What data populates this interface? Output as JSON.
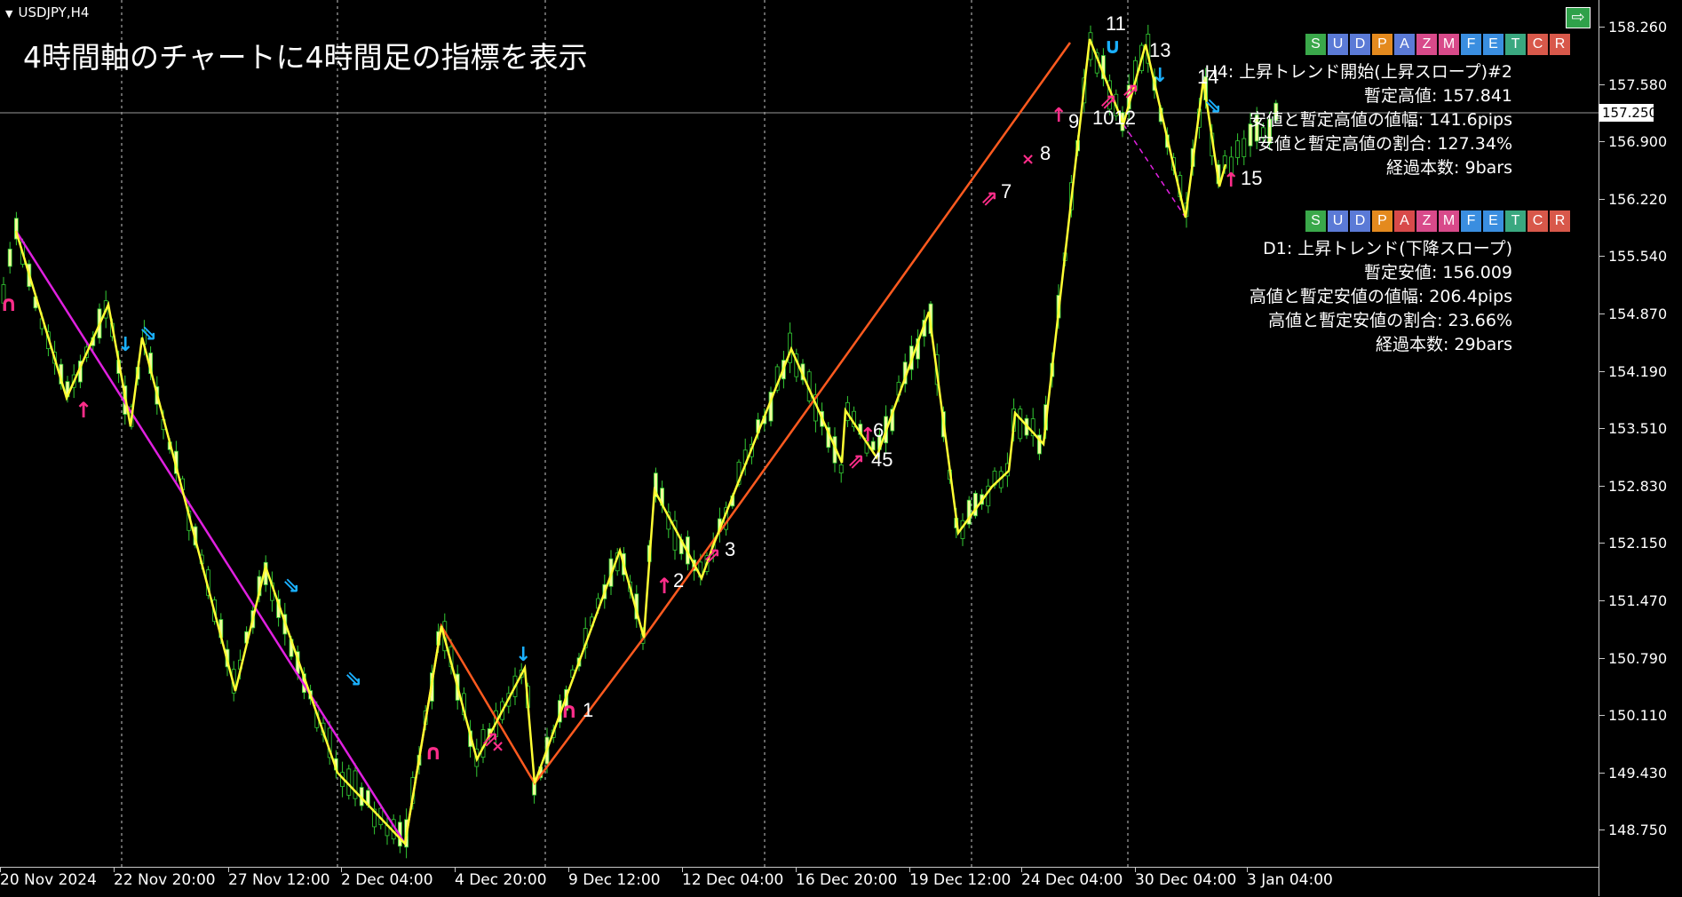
{
  "chart": {
    "symbol": "USDJPY,H4",
    "title": "4時間軸のチャートに4時間足の指標を表示",
    "current_price": "157.250"
  },
  "price_axis": [
    "158.260",
    "157.580",
    "156.900",
    "156.220",
    "155.540",
    "154.870",
    "154.190",
    "153.510",
    "152.830",
    "152.150",
    "151.470",
    "150.790",
    "150.110",
    "149.430",
    "148.750"
  ],
  "time_axis": [
    "20 Nov 2024",
    "22 Nov 20:00",
    "27 Nov 12:00",
    "2 Dec 04:00",
    "4 Dec 20:00",
    "9 Dec 12:00",
    "12 Dec 04:00",
    "16 Dec 20:00",
    "19 Dec 12:00",
    "24 Dec 04:00",
    "30 Dec 04:00",
    "3 Jan 04:00"
  ],
  "toolbar_buttons": [
    {
      "label": "S",
      "color": "#3aa84a"
    },
    {
      "label": "U",
      "color": "#5b7ad6"
    },
    {
      "label": "D",
      "color": "#5b7ad6"
    },
    {
      "label": "P",
      "color": "#e48a1e"
    },
    {
      "label": "A",
      "color": "#5b7ad6"
    },
    {
      "label": "Z",
      "color": "#d84a8a"
    },
    {
      "label": "M",
      "color": "#d84a8a"
    },
    {
      "label": "F",
      "color": "#3a8ee0"
    },
    {
      "label": "E",
      "color": "#3a8ee0"
    },
    {
      "label": "T",
      "color": "#3aa880"
    },
    {
      "label": "C",
      "color": "#d8584a"
    },
    {
      "label": "R",
      "color": "#d8584a"
    }
  ],
  "toolbar_buttons_2": [
    {
      "label": "S",
      "color": "#3aa84a"
    },
    {
      "label": "U",
      "color": "#5b7ad6"
    },
    {
      "label": "D",
      "color": "#5b7ad6"
    },
    {
      "label": "P",
      "color": "#e48a1e"
    },
    {
      "label": "A",
      "color": "#d84a4a"
    },
    {
      "label": "Z",
      "color": "#d84a8a"
    },
    {
      "label": "M",
      "color": "#d84a8a"
    },
    {
      "label": "F",
      "color": "#3a8ee0"
    },
    {
      "label": "E",
      "color": "#3a8ee0"
    },
    {
      "label": "T",
      "color": "#3aa880"
    },
    {
      "label": "C",
      "color": "#d8584a"
    },
    {
      "label": "R",
      "color": "#d8584a"
    }
  ],
  "h4_panel": {
    "line1": "H4: 上昇トレンド開始(上昇スロープ)#2",
    "line2": "暫定高値: 157.841",
    "line3": "安値と暫定高値の値幅: 141.6pips",
    "line4": "安値と暫定高値の割合: 127.34%",
    "line5": "経過本数: 9bars"
  },
  "d1_panel": {
    "line1": "D1: 上昇トレンド(下降スロープ)",
    "line2": "暫定安値: 156.009",
    "line3": "高値と暫定安値の値幅: 206.4pips",
    "line4": "高値と暫定安値の割合: 23.66%",
    "line5": "経過本数: 29bars"
  },
  "point_labels": [
    "1",
    "2",
    "3",
    "45",
    "6",
    "7",
    "8",
    "9",
    "1012",
    "11",
    "13",
    "14",
    "15"
  ],
  "colors": {
    "zigzag_yellow": "#ffff33",
    "trend_orange": "#ff5a1f",
    "trend_magenta": "#e020e0",
    "candle_up": "#f0ff9a",
    "candle_wick": "#33cc33",
    "arrow_pink": "#ff2d8a",
    "arrow_cyan": "#1ab0ff"
  }
}
